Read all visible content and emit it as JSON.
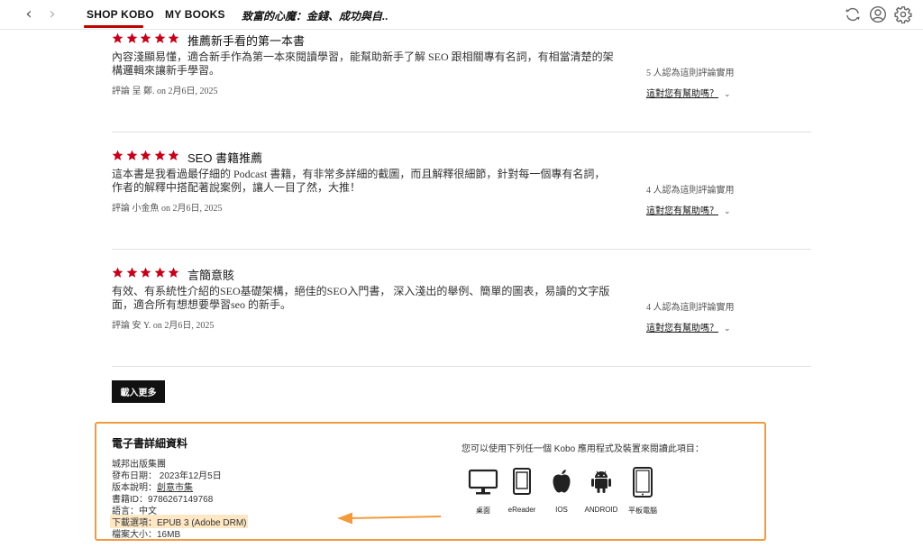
{
  "nav": {
    "tabs": [
      {
        "label": "SHOP KOBO",
        "active": true
      },
      {
        "label": "MY BOOKS",
        "active": false
      }
    ],
    "book_title": "致富的心魔：金錢、成功與自..",
    "icons": [
      "back-arrow-icon",
      "forward-arrow-icon",
      "sync-icon",
      "user-icon",
      "gear-icon"
    ],
    "accent_color": "#bf0000"
  },
  "reviews": [
    {
      "title": "推薦新手看的第一本書",
      "rating": 5,
      "body": [
        "內容淺顯易懂，適合新手作為第一本來閱讀學習，能幫助新手了解 SEO 跟相關專有名詞，有相當清楚的架",
        "構邏輯來讓新手學習。"
      ],
      "meta": "評論 呈 鄭. on 2月6日, 2025",
      "helpful_count": "5 人認為這則評論實用",
      "helpful_question": "這對您有幫助嗎？"
    },
    {
      "title": "SEO 書籍推薦",
      "rating": 5,
      "body": [
        "這本書是我看過最仔細的 Podcast 書籍，有非常多詳細的截圖，而且解釋很細節，針對每一個專有名詞，",
        "作者的解釋中搭配著說案例，讓人一目了然，大推！"
      ],
      "meta": "評論 小金魚 on 2月6日, 2025",
      "helpful_count": "4 人認為這則評論實用",
      "helpful_question": "這對您有幫助嗎？"
    },
    {
      "title": "言簡意賅",
      "rating": 5,
      "body": [
        "有效、有系統性介紹的SEO基礎架構，絕佳的SEO入門書， 深入淺出的舉例、簡單的圖表，易讀的文字版",
        "面，適合所有想想要學習seo 的新手。"
      ],
      "meta": "評論 安 Y. on 2月6日, 2025",
      "helpful_count": "4 人認為這則評論實用",
      "helpful_question": "這對您有幫助嗎？"
    }
  ],
  "star_color": "#c4001a",
  "load_more_label": "載入更多",
  "details": {
    "heading": "電子書詳細資料",
    "publisher": "城邦出版集團",
    "pub_date": "發布日期： 2023年12月5日",
    "imprint_label": "版本說明：",
    "imprint_value": "創意市集",
    "book_id": "書籍ID：9786267149768",
    "language": "語言：中文",
    "download_option": "下載選項：EPUB 3 (Adobe DRM)",
    "file_size": "檔案大小：16MB",
    "highlight_color": "#f29b3d",
    "apps_title": "您可以使用下列任一個 Kobo 應用程式及裝置來閱讀此項目：",
    "devices": [
      {
        "label": "桌面",
        "icon": "desktop-icon"
      },
      {
        "label": "eReader",
        "icon": "ereader-icon"
      },
      {
        "label": "IOS",
        "icon": "apple-icon"
      },
      {
        "label": "ANDROID",
        "icon": "android-icon"
      },
      {
        "label": "平板電腦",
        "icon": "tablet-icon"
      }
    ]
  }
}
